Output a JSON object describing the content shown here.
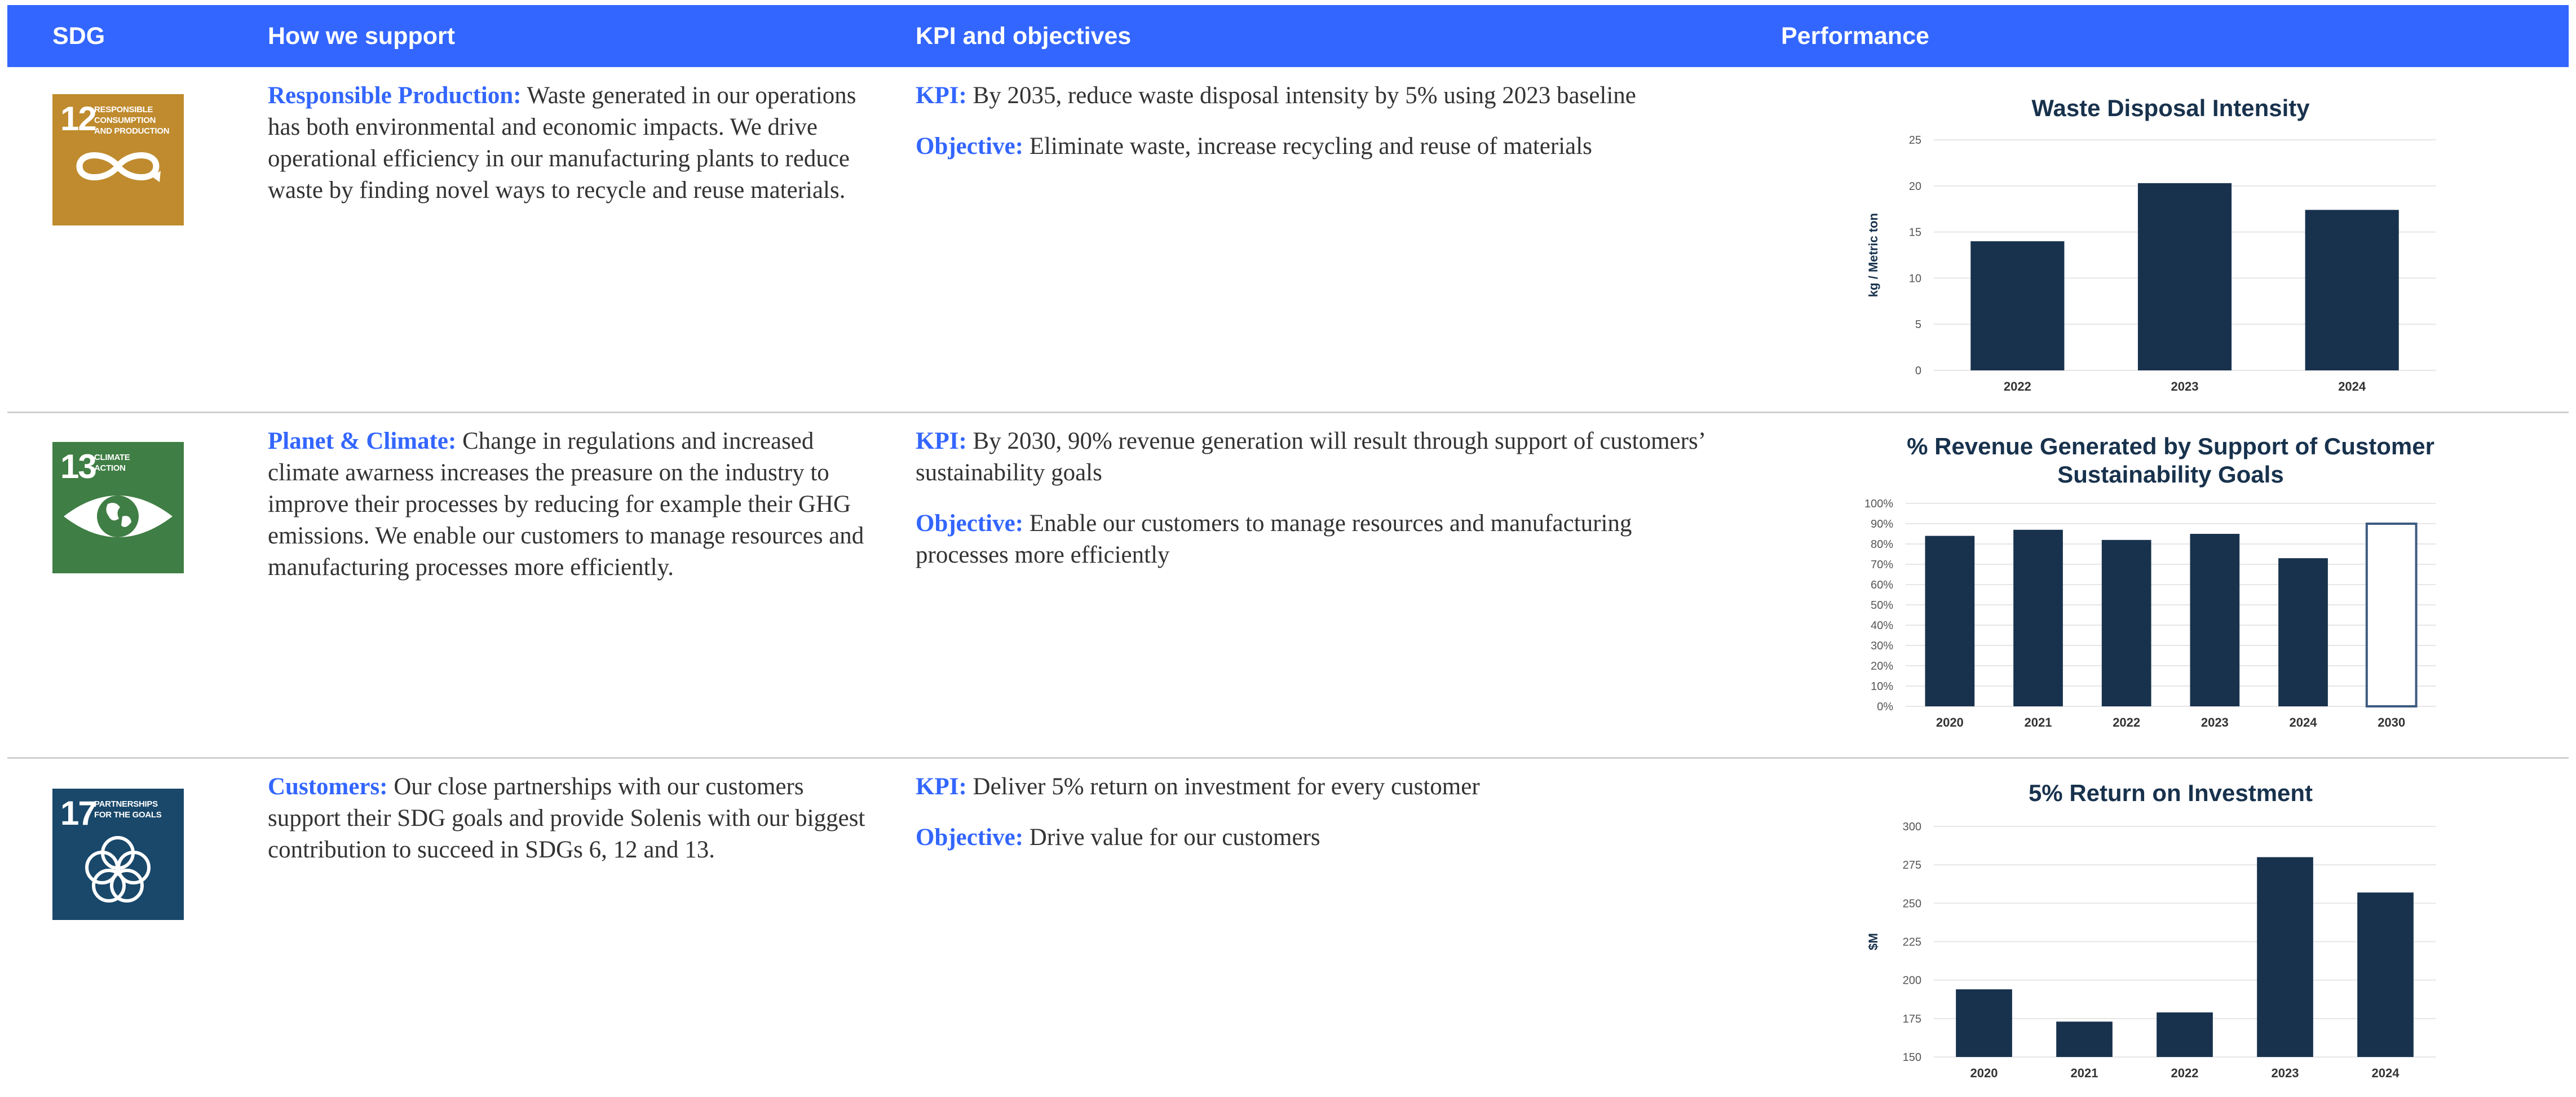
{
  "header": {
    "col_sdg": "SDG",
    "col_support": "How we support",
    "col_kpi": "KPI and objectives",
    "col_performance": "Performance",
    "color": "#3366ff"
  },
  "rows": [
    {
      "sdg": {
        "number": "12",
        "title": "RESPONSIBLE\nCONSUMPTION\nAND PRODUCTION",
        "color": "#bf8b2e",
        "icon": "infinity-loop-icon"
      },
      "support": {
        "lead": "Responsible Production:",
        "text": " Waste generated in our operations has both environmental and economic impacts.  We drive operational efficiency in our manufacturing plants to reduce waste by finding novel ways to recycle and reuse materials."
      },
      "kpi": {
        "kpi_lead": "KPI:",
        "kpi_text": " By 2035, reduce waste disposal intensity by 5% using 2023 baseline",
        "obj_lead": "Objective:",
        "obj_text": " Eliminate waste, increase recycling and reuse of materials"
      }
    },
    {
      "sdg": {
        "number": "13",
        "title": "CLIMATE\nACTION",
        "color": "#3f7e44",
        "icon": "eye-globe-icon"
      },
      "support": {
        "lead": "Planet & Climate:",
        "text": " Change in regulations and increased climate awarness increases the preasure on the industry to improve their processes by reducing for example their GHG emissions. We enable our customers to manage resources and manufacturing processes more efficiently."
      },
      "kpi": {
        "kpi_lead": "KPI:",
        "kpi_text": " By 2030, 90% revenue generation will result through support of customers’ sustainability goals",
        "obj_lead": "Objective:",
        "obj_text": " Enable our customers to manage resources and manufacturing processes more efficiently"
      }
    },
    {
      "sdg": {
        "number": "17",
        "title": "PARTNERSHIPS\nFOR THE GOALS",
        "color": "#19486a",
        "icon": "interlocking-rings-icon"
      },
      "support": {
        "lead": "Customers:",
        "text": " Our close partnerships with our customers support their SDG goals and provide Solenis with our biggest contribution to succeed in SDGs 6, 12 and 13."
      },
      "kpi": {
        "kpi_lead": "KPI:",
        "kpi_text": " Deliver 5% return on investment for every customer",
        "obj_lead": "Objective:",
        "obj_text": " Drive value for our customers"
      }
    }
  ],
  "chart_data": [
    {
      "type": "bar",
      "title": "Waste Disposal Intensity",
      "ylabel": "kg / Metric ton",
      "xlabel": "",
      "categories": [
        "2022",
        "2023",
        "2024"
      ],
      "values": [
        14,
        20.3,
        17.4
      ],
      "ylim": [
        0,
        25
      ],
      "yticks": [
        "0",
        "5",
        "10",
        "15",
        "20",
        "25"
      ],
      "grid": true,
      "bar_color": "#18324d"
    },
    {
      "type": "bar",
      "title": "% Revenue Generated by Support of Customer Sustainability Goals",
      "ylabel": "",
      "xlabel": "",
      "categories": [
        "2020",
        "2021",
        "2022",
        "2023",
        "2024",
        "2030"
      ],
      "values": [
        84,
        87,
        82,
        85,
        73,
        90
      ],
      "target_categories": [
        "2030"
      ],
      "ylim": [
        0,
        100
      ],
      "yticks": [
        "0%",
        "10%",
        "20%",
        "30%",
        "40%",
        "50%",
        "60%",
        "70%",
        "80%",
        "90%",
        "100%"
      ],
      "grid": true,
      "bar_color": "#18324d",
      "target_outline_color": "#3d5a80"
    },
    {
      "type": "bar",
      "title": "5% Return on Investment",
      "ylabel": "$M",
      "xlabel": "",
      "categories": [
        "2020",
        "2021",
        "2022",
        "2023",
        "2024"
      ],
      "values": [
        194,
        173,
        179,
        280,
        257
      ],
      "ylim": [
        150,
        300
      ],
      "yticks": [
        "150",
        "175",
        "200",
        "225",
        "250",
        "275",
        "300"
      ],
      "grid": true,
      "bar_color": "#18324d"
    }
  ]
}
